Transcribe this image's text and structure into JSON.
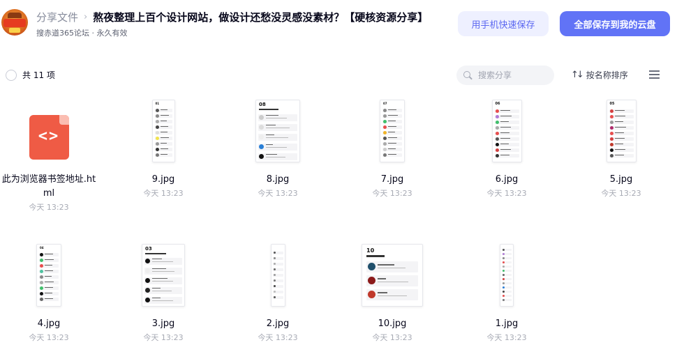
{
  "header": {
    "breadcrumb": "分享文件",
    "title": "熬夜整理上百个设计网站，做设计还愁没灵感没素材？【硬核资源分享】",
    "subtitle": "搜赤道365论坛 · 永久有效",
    "btn_mobile_save": "用手机快速保存",
    "btn_save_all": "全部保存到我的云盘"
  },
  "toolbar": {
    "count_label": "共 11 项",
    "search_placeholder": "搜索分享",
    "sort_label": "按名称排序"
  },
  "files": [
    {
      "name": "此为浏览器书签地址.html",
      "time": "今天 13:23",
      "kind": "html"
    },
    {
      "name": "9.jpg",
      "time": "今天 13:23",
      "kind": "image"
    },
    {
      "name": "8.jpg",
      "time": "今天 13:23",
      "kind": "image"
    },
    {
      "name": "7.jpg",
      "time": "今天 13:23",
      "kind": "image"
    },
    {
      "name": "6.jpg",
      "time": "今天 13:23",
      "kind": "image"
    },
    {
      "name": "5.jpg",
      "time": "今天 13:23",
      "kind": "image"
    },
    {
      "name": "4.jpg",
      "time": "今天 13:23",
      "kind": "image"
    },
    {
      "name": "3.jpg",
      "time": "今天 13:23",
      "kind": "image"
    },
    {
      "name": "2.jpg",
      "time": "今天 13:23",
      "kind": "image"
    },
    {
      "name": "10.jpg",
      "time": "今天 13:23",
      "kind": "image"
    },
    {
      "name": "1.jpg",
      "time": "今天 13:23",
      "kind": "image"
    }
  ],
  "colors": {
    "primary": "#6173f6",
    "primary_light": "#eef0ff",
    "html_icon": "#ef5b45",
    "muted_text": "#a7aab4"
  },
  "icons": {
    "file_type_html": "code-icon",
    "search": "search-icon",
    "sort": "sort-icon",
    "menu": "menu-icon",
    "breadcrumb_separator": "chevron-right-icon"
  }
}
